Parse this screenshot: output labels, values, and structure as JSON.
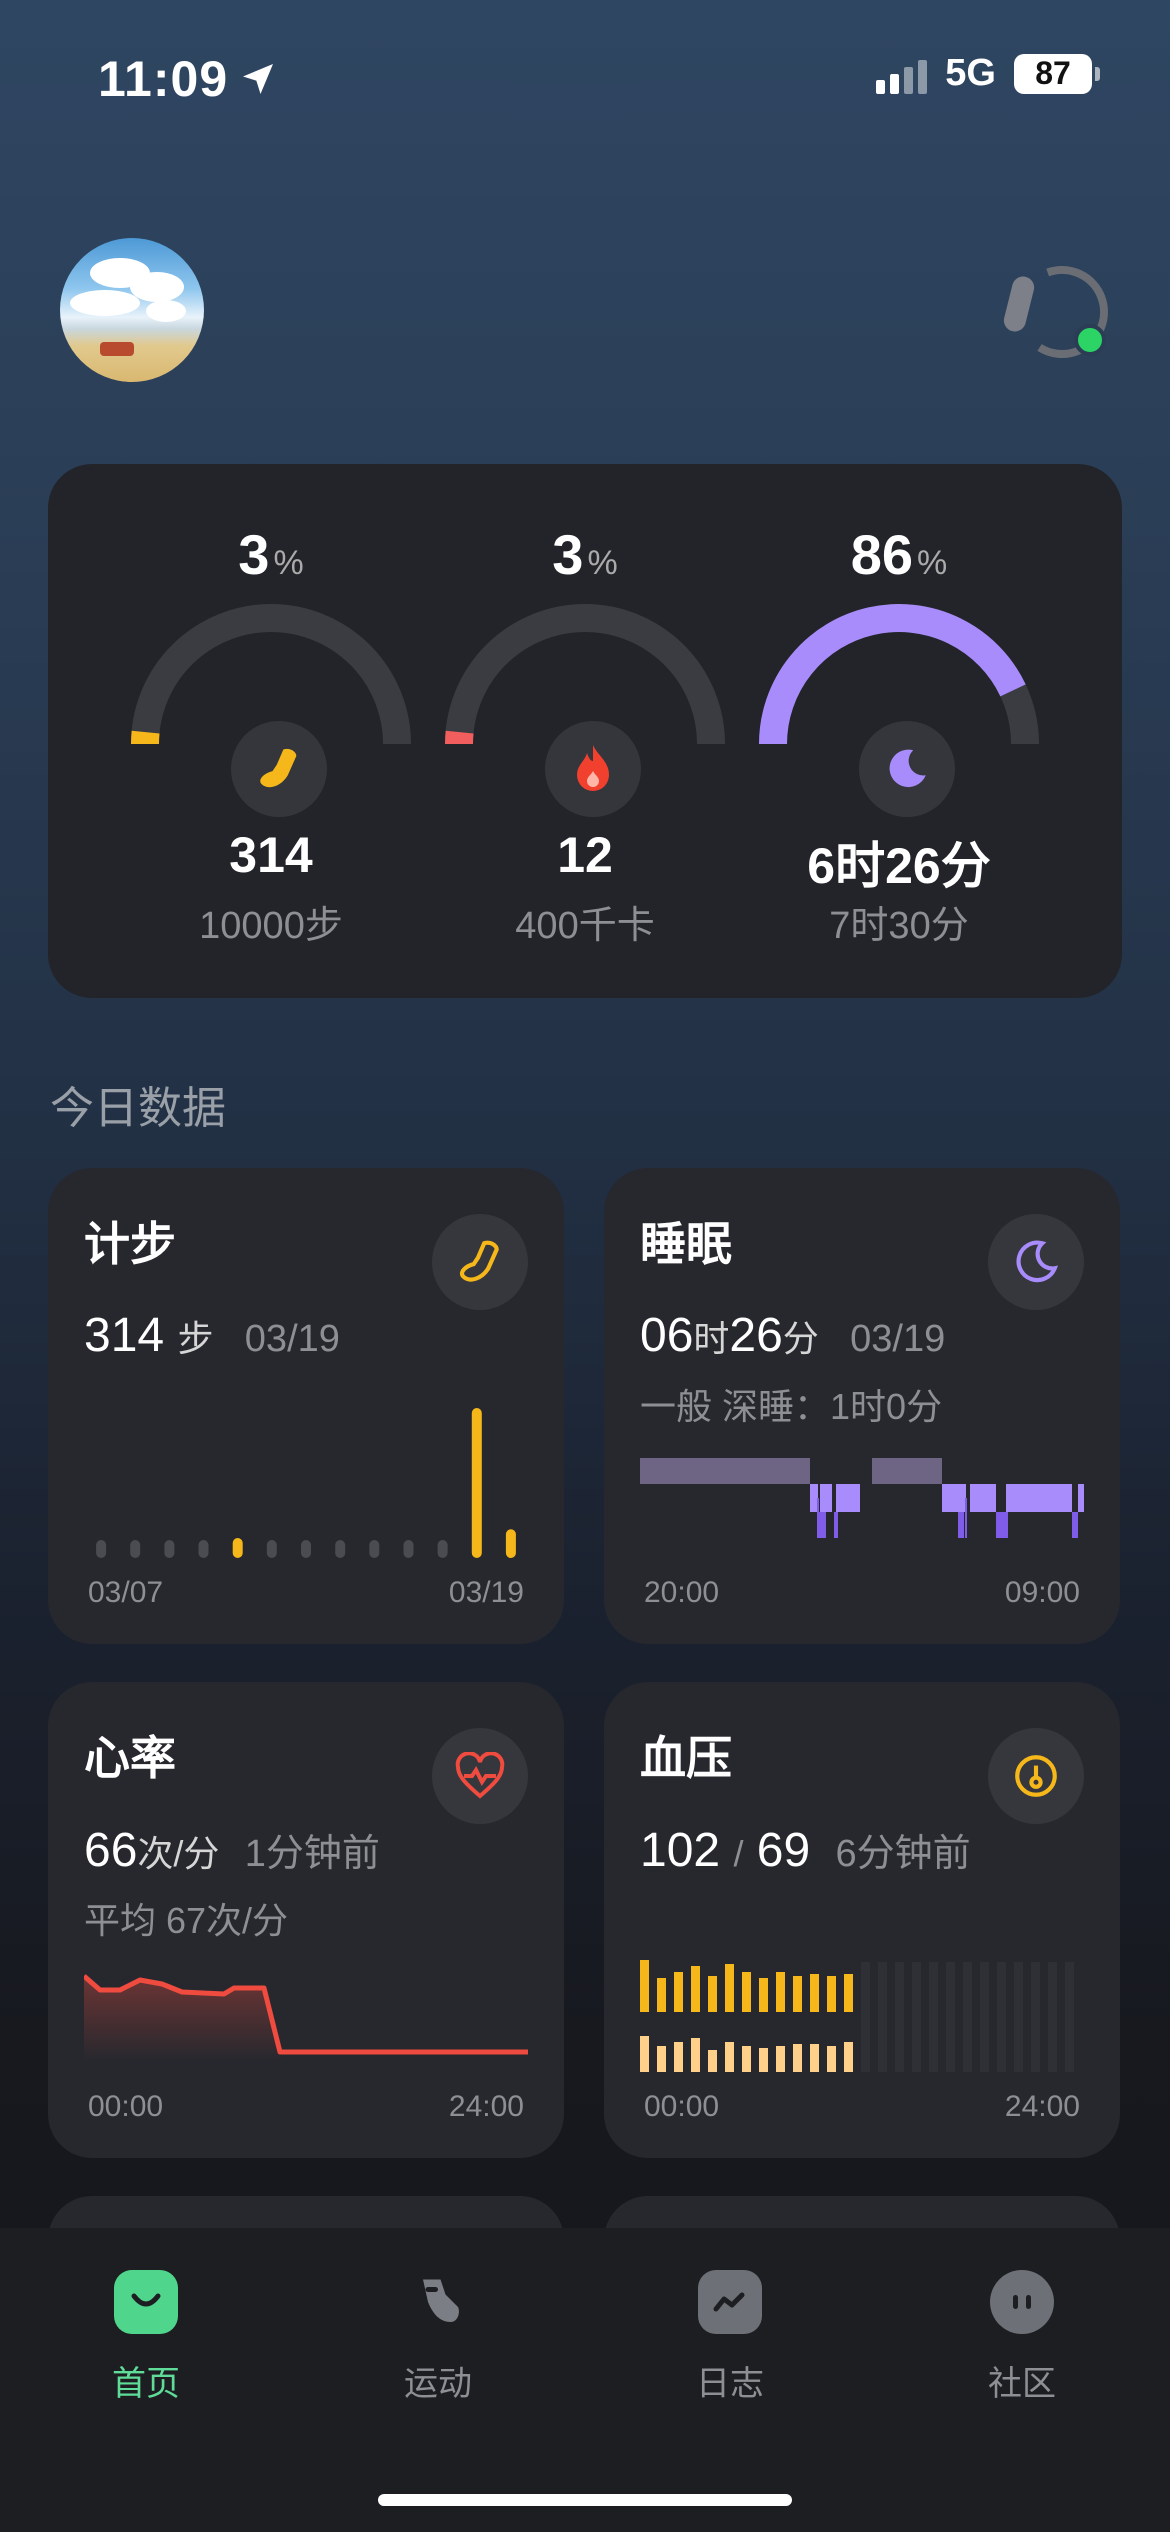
{
  "status": {
    "time": "11:09",
    "network": "5G",
    "battery": "87"
  },
  "summary": {
    "steps": {
      "percent": "3",
      "percent_unit": "%",
      "value": "314",
      "goal": "10000步",
      "fraction": 0.03,
      "color": "#f6b71b"
    },
    "calories": {
      "percent": "3",
      "percent_unit": "%",
      "value": "12",
      "goal": "400千卡",
      "fraction": 0.03,
      "color": "#f25d5d"
    },
    "sleep": {
      "percent": "86",
      "percent_unit": "%",
      "value": "6时26分",
      "goal": "7时30分",
      "fraction": 0.86,
      "color": "#a88cfb"
    }
  },
  "section_title": "今日数据",
  "cards": {
    "steps": {
      "title": "计步",
      "value": "314",
      "unit": "步",
      "date": "03/19",
      "axis_start": "03/07",
      "axis_end": "03/19",
      "daily": [
        0,
        0,
        0,
        0,
        6,
        0,
        0,
        0,
        0,
        0,
        0,
        314,
        60
      ]
    },
    "sleep": {
      "title": "睡眠",
      "hours": "06",
      "hours_unit": "时",
      "minutes": "26",
      "minutes_unit": "分",
      "date": "03/19",
      "quality": "一般",
      "deep_sleep": "深睡：1时0分",
      "axis_start": "20:00",
      "axis_end": "09:00"
    },
    "heart": {
      "title": "心率",
      "value": "66",
      "unit": "次/分",
      "ago": "1分钟前",
      "average": "平均  67次/分",
      "axis_start": "00:00",
      "axis_end": "24:00"
    },
    "bp": {
      "title": "血压",
      "systolic": "102",
      "separator": "/",
      "diastolic": "69",
      "ago": "6分钟前",
      "axis_start": "00:00",
      "axis_end": "24:00"
    }
  },
  "tabs": [
    {
      "label": "首页",
      "icon": "home-face-icon",
      "active": true
    },
    {
      "label": "运动",
      "icon": "shoe-icon",
      "active": false
    },
    {
      "label": "日志",
      "icon": "trend-icon",
      "active": false
    },
    {
      "label": "社区",
      "icon": "chat-face-icon",
      "active": false
    }
  ],
  "colors": {
    "accent_green": "#5fdc98",
    "steps": "#f6b71b",
    "heart": "#ef4b3f",
    "sleep": "#a88cfb"
  }
}
